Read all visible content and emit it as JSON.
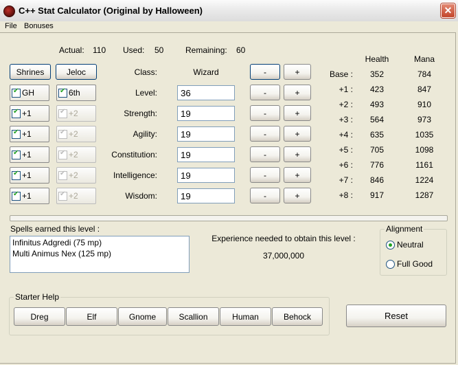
{
  "window": {
    "title": "C++ Stat Calculator (Original by Halloween)"
  },
  "menu": [
    "File",
    "Bonuses"
  ],
  "summary": {
    "actual_label": "Actual:",
    "actual_value": "110",
    "used_label": "Used:",
    "used_value": "50",
    "remaining_label": "Remaining:",
    "remaining_value": "60"
  },
  "bonuses": {
    "shrines": "Shrines",
    "jeloc": "Jeloc",
    "rows": [
      {
        "left": "GH",
        "right": "6th"
      },
      {
        "left": "+1",
        "right": "+2"
      },
      {
        "left": "+1",
        "right": "+2"
      },
      {
        "left": "+1",
        "right": "+2"
      },
      {
        "left": "+1",
        "right": "+2"
      },
      {
        "left": "+1",
        "right": "+2"
      }
    ]
  },
  "class_row": {
    "label": "Class:",
    "value": "Wizard"
  },
  "stats": [
    {
      "label": "Level:",
      "value": "36"
    },
    {
      "label": "Strength:",
      "value": "19"
    },
    {
      "label": "Agility:",
      "value": "19"
    },
    {
      "label": "Constitution:",
      "value": "19"
    },
    {
      "label": "Intelligence:",
      "value": "19"
    },
    {
      "label": "Wisdom:",
      "value": "19"
    }
  ],
  "buttons": {
    "minus": "-",
    "plus": "+",
    "reset": "Reset"
  },
  "health_mana": {
    "health_header": "Health",
    "mana_header": "Mana",
    "rows": [
      {
        "label": "Base :",
        "health": "352",
        "mana": "784"
      },
      {
        "label": "+1 :",
        "health": "423",
        "mana": "847"
      },
      {
        "label": "+2 :",
        "health": "493",
        "mana": "910"
      },
      {
        "label": "+3 :",
        "health": "564",
        "mana": "973"
      },
      {
        "label": "+4 :",
        "health": "635",
        "mana": "1035"
      },
      {
        "label": "+5 :",
        "health": "705",
        "mana": "1098"
      },
      {
        "label": "+6 :",
        "health": "776",
        "mana": "1161"
      },
      {
        "label": "+7 :",
        "health": "846",
        "mana": "1224"
      },
      {
        "label": "+8 :",
        "health": "917",
        "mana": "1287"
      }
    ]
  },
  "spells": {
    "label": "Spells earned this level :",
    "items": [
      "Infinitus Adgredi (75 mp)",
      "Multi Animus Nex (125 mp)"
    ]
  },
  "experience": {
    "label": "Experience needed to obtain this level :",
    "value": "37,000,000"
  },
  "alignment": {
    "title": "Alignment",
    "options": [
      "Neutral",
      "Full Good"
    ],
    "selected": "Neutral"
  },
  "starter_help": {
    "title": "Starter Help",
    "races": [
      "Dreg",
      "Elf",
      "Gnome",
      "Scallion",
      "Human",
      "Behock"
    ]
  }
}
